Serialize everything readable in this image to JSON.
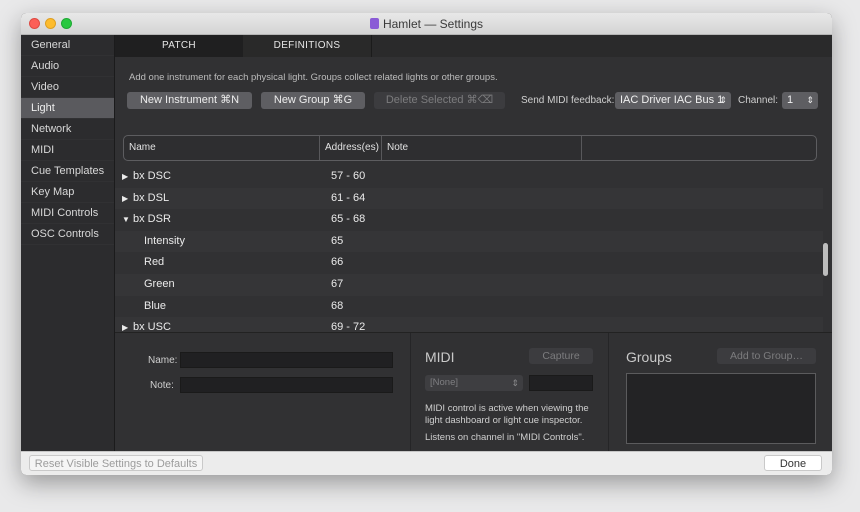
{
  "window": {
    "title": "Hamlet — Settings"
  },
  "sidebar": {
    "items": [
      {
        "label": "General"
      },
      {
        "label": "Audio"
      },
      {
        "label": "Video"
      },
      {
        "label": "Light"
      },
      {
        "label": "Network"
      },
      {
        "label": "MIDI"
      },
      {
        "label": "Cue Templates"
      },
      {
        "label": "Key Map"
      },
      {
        "label": "MIDI Controls"
      },
      {
        "label": "OSC Controls"
      }
    ],
    "selected": "Light"
  },
  "tabs": [
    {
      "label": "PATCH"
    },
    {
      "label": "DEFINITIONS"
    }
  ],
  "toolbar": {
    "hint": "Add one instrument for each physical light.  Groups collect related lights or other groups.",
    "new_instrument": "New Instrument  ⌘N",
    "new_group": "New Group  ⌘G",
    "delete_selected": "Delete Selected  ⌘⌫",
    "feedback_label": "Send MIDI feedback:",
    "feedback_value": "IAC Driver IAC Bus 1",
    "channel_label": "Channel:",
    "channel_value": "1"
  },
  "table": {
    "columns": [
      "Name",
      "Address(es)",
      "Note",
      ""
    ],
    "rows": [
      {
        "name": "bx DSC",
        "address": "57 - 60",
        "arrow": "▶"
      },
      {
        "name": "bx DSL",
        "address": "61 - 64",
        "arrow": "▶"
      },
      {
        "name": "bx DSR",
        "address": "65 - 68",
        "arrow": "▼"
      },
      {
        "name": "Intensity",
        "address": "65",
        "arrow": ""
      },
      {
        "name": "Red",
        "address": "66",
        "arrow": ""
      },
      {
        "name": "Green",
        "address": "67",
        "arrow": ""
      },
      {
        "name": "Blue",
        "address": "68",
        "arrow": ""
      },
      {
        "name": "bx USC",
        "address": "69 - 72",
        "arrow": "▶"
      }
    ]
  },
  "inspector": {
    "name_label": "Name:",
    "note_label": "Note:",
    "midi_title": "MIDI",
    "capture": "Capture",
    "midi_select": "[None]",
    "midi_note1": "MIDI control is active when viewing the light dashboard or light cue inspector.",
    "midi_note2": "Listens on channel in \"MIDI Controls\".",
    "groups_title": "Groups",
    "add_to_group": "Add to Group…"
  },
  "footer": {
    "reset": "Reset Visible Settings to Defaults",
    "done": "Done"
  }
}
